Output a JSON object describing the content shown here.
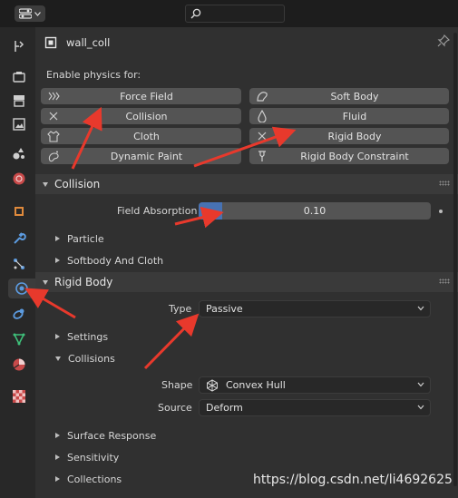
{
  "header": {
    "editor_icon": "properties-editor-icon",
    "search_placeholder": ""
  },
  "sidebar_tabs": [
    {
      "icon": "tool-icon"
    },
    {
      "icon": "render-icon"
    },
    {
      "icon": "output-icon"
    },
    {
      "icon": "view-layer-icon"
    },
    {
      "icon": "scene-icon"
    },
    {
      "icon": "world-icon"
    },
    {
      "icon": "object-icon"
    },
    {
      "icon": "modifier-icon"
    },
    {
      "icon": "particles-icon"
    },
    {
      "icon": "physics-icon"
    },
    {
      "icon": "constraints-icon"
    },
    {
      "icon": "data-icon"
    },
    {
      "icon": "material-icon"
    },
    {
      "icon": "texture-icon"
    }
  ],
  "object": {
    "name": "wall_coll"
  },
  "physics": {
    "enable_label": "Enable physics for:",
    "buttons": [
      {
        "label": "Force Field",
        "icon": "force-field-icon"
      },
      {
        "label": "Soft Body",
        "icon": "soft-body-icon"
      },
      {
        "label": "Collision",
        "icon": "remove-x-icon"
      },
      {
        "label": "Fluid",
        "icon": "fluid-icon"
      },
      {
        "label": "Cloth",
        "icon": "cloth-icon"
      },
      {
        "label": "Rigid Body",
        "icon": "remove-x-icon"
      },
      {
        "label": "Dynamic Paint",
        "icon": "dynamic-paint-icon"
      },
      {
        "label": "Rigid Body Constraint",
        "icon": "constraint-icon"
      }
    ]
  },
  "collision": {
    "title": "Collision",
    "field_absorption_label": "Field Absorption",
    "field_absorption_value": "0.10",
    "field_absorption_fraction": 0.1,
    "subpanels": [
      "Particle",
      "Softbody And Cloth"
    ]
  },
  "rigid_body": {
    "title": "Rigid Body",
    "type_label": "Type",
    "type_value": "Passive",
    "settings_label": "Settings",
    "collisions_label": "Collisions",
    "shape_label": "Shape",
    "shape_value": "Convex Hull",
    "source_label": "Source",
    "source_value": "Deform",
    "subpanels": [
      "Surface Response",
      "Sensitivity",
      "Collections"
    ]
  },
  "watermark": "https://blog.csdn.net/li4692625",
  "colors": {
    "accent": "#4772b3",
    "annotation": "#e8392c",
    "panel": "#303030",
    "button": "#545454"
  }
}
